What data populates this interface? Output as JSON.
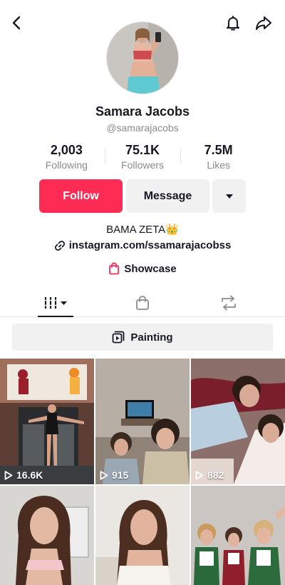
{
  "profile": {
    "display_name": "Samara Jacobs",
    "username": "@samarajacobs",
    "bio": "BAMA ZETA",
    "bio_emoji": "👑",
    "link": "instagram.com/ssamarajacobss",
    "showcase": "Showcase"
  },
  "stats": {
    "following_count": "2,003",
    "following_label": "Following",
    "followers_count": "75.1K",
    "followers_label": "Followers",
    "likes_count": "7.5M",
    "likes_label": "Likes"
  },
  "actions": {
    "follow": "Follow",
    "message": "Message"
  },
  "playlist": {
    "label": "Painting"
  },
  "videos": [
    {
      "views": "16.6K"
    },
    {
      "views": "915"
    },
    {
      "views": "882"
    },
    {
      "views": ""
    },
    {
      "views": ""
    },
    {
      "views": ""
    }
  ],
  "colors": {
    "accent": "#fe2c55",
    "secondary_button": "#f1f1f2",
    "muted_text": "#8a8b91",
    "primary_text": "#161823"
  },
  "icons": [
    "back-icon",
    "bell-icon",
    "share-icon",
    "caret-down-icon",
    "link-icon",
    "shopping-bag-icon",
    "grid-icon",
    "repost-icon",
    "playlist-icon",
    "play-icon"
  ]
}
